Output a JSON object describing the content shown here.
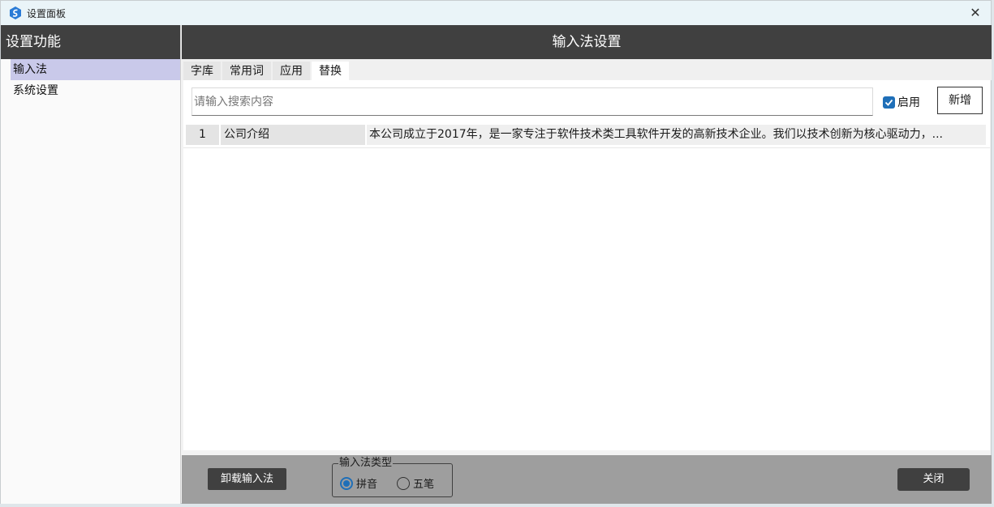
{
  "window": {
    "title": "设置面板",
    "close_glyph": "✕"
  },
  "sidebar": {
    "header": "设置功能",
    "items": [
      {
        "label": "输入法",
        "active": true
      },
      {
        "label": "系统设置",
        "active": false
      }
    ]
  },
  "main": {
    "header": "输入法设置",
    "tabs": [
      {
        "label": "字库",
        "active": false
      },
      {
        "label": "常用词",
        "active": false
      },
      {
        "label": "应用",
        "active": false
      },
      {
        "label": "替换",
        "active": true
      }
    ],
    "search": {
      "placeholder": "请输入搜索内容",
      "value": ""
    },
    "enable": {
      "label": "启用",
      "checked": true
    },
    "add_button": "新增",
    "rows": [
      {
        "index": "1",
        "name": "公司介绍",
        "value": "本公司成立于2017年，是一家专注于软件技术类工具软件开发的高新技术企业。我们以技术创新为核心驱动力，..."
      }
    ]
  },
  "footer": {
    "uninstall_button": "卸载输入法",
    "ime_type": {
      "title": "输入法类型",
      "options": [
        {
          "label": "拼音",
          "selected": true
        },
        {
          "label": "五笔",
          "selected": false
        }
      ]
    },
    "close_button": "关闭"
  },
  "colors": {
    "accent": "#1f6fb8",
    "header_bg": "#404040",
    "active_item_bg": "#c9c9ea",
    "footer_bg": "#9e9e9e"
  }
}
